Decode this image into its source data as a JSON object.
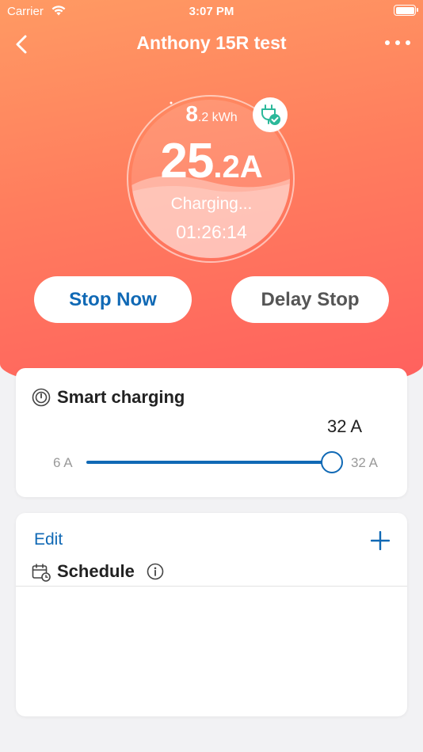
{
  "status_bar": {
    "carrier": "Carrier",
    "time": "3:07 PM"
  },
  "nav": {
    "title": "Anthony 15R test",
    "back_icon": "chevron-left-icon",
    "more_icon": "more-horizontal-icon"
  },
  "gauge": {
    "energy_int": "8",
    "energy_dec": ".2 kWh",
    "current_int": "25",
    "current_dec": ".2A",
    "status": "Charging...",
    "timer": "01:26:14",
    "badge_icon": "plug-check-icon"
  },
  "actions": {
    "stop_now": "Stop Now",
    "delay_stop": "Delay Stop"
  },
  "smart_charging": {
    "title": "Smart charging",
    "icon": "smart-charge-icon",
    "current_value": "32 A",
    "min_label": "6 A",
    "max_label": "32 A",
    "slider_value": 32,
    "slider_min": 6,
    "slider_max": 32
  },
  "schedule": {
    "edit_label": "Edit",
    "title": "Schedule",
    "icon": "calendar-clock-icon",
    "info_icon": "info-icon",
    "add_icon": "plus-icon"
  },
  "colors": {
    "accent_blue": "#1069b5",
    "hero_top": "#ff9a63",
    "hero_bottom": "#ff5f5e",
    "badge_green": "#2bb89a"
  }
}
